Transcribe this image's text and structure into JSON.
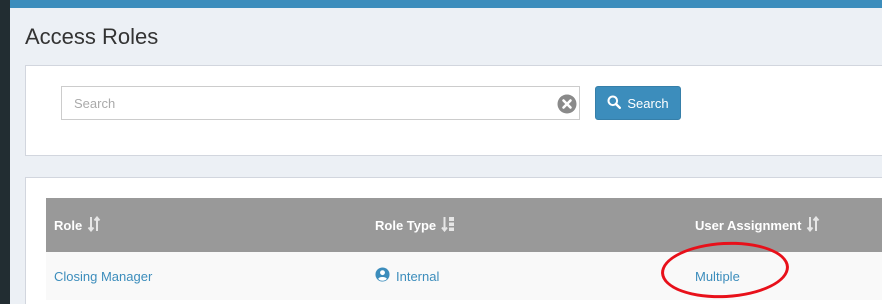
{
  "page": {
    "title": "Access Roles"
  },
  "search": {
    "placeholder": "Search",
    "value": "",
    "button_label": "Search"
  },
  "table": {
    "columns": [
      {
        "label": "Role"
      },
      {
        "label": "Role Type"
      },
      {
        "label": "User Assignment"
      }
    ],
    "rows": [
      {
        "role": "Closing Manager",
        "role_type": "Internal",
        "user_assignment": "Multiple"
      }
    ]
  },
  "colors": {
    "accent": "#3c8dbc",
    "header_bg": "#999999",
    "annotation": "#e8101a",
    "sidebar": "#222d32"
  },
  "icons": {
    "clear": "times-circle-icon",
    "search": "search-icon",
    "sort": "sort-icon",
    "sort_alpha": "sort-alpha-icon",
    "role_type": "user-circle-icon"
  }
}
